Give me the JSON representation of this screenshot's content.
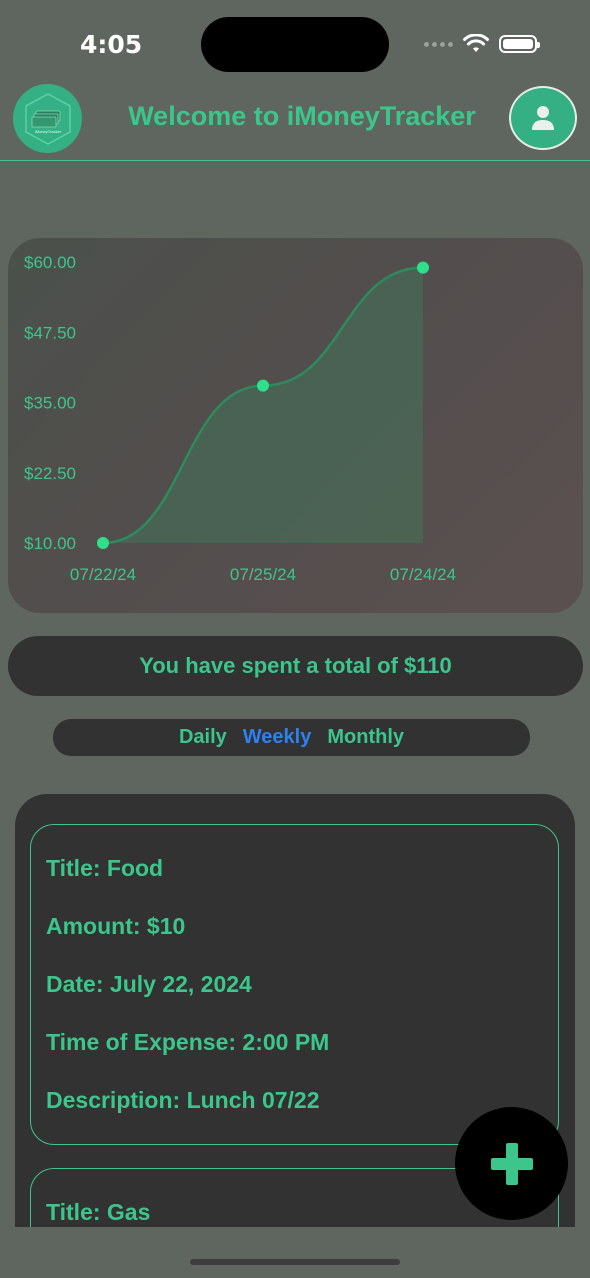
{
  "status_bar": {
    "time": "4:05"
  },
  "header": {
    "title": "Welcome to iMoneyTracker",
    "logo_text": "iMoneyTracker"
  },
  "chart_data": {
    "type": "line",
    "x": [
      "07/22/24",
      "07/25/24",
      "07/24/24"
    ],
    "values": [
      10,
      38,
      59
    ],
    "ytick_labels": [
      "$60.00",
      "$47.50",
      "$35.00",
      "$22.50",
      "$10.00"
    ],
    "ytick_values": [
      60,
      47.5,
      35,
      22.5,
      10
    ],
    "ylim": [
      10,
      60
    ],
    "area_fill": true,
    "smooth": true,
    "colors": {
      "line": "#2e8a5f",
      "point": "#2fe08a",
      "fill": "#3a8a62"
    }
  },
  "summary": {
    "total_text": "You have spent a total of $110"
  },
  "period_selector": {
    "options": [
      "Daily",
      "Weekly",
      "Monthly"
    ],
    "selected": "Weekly"
  },
  "expenses": [
    {
      "title": "Title: Food",
      "amount": "Amount: $10",
      "date": "Date: July 22, 2024",
      "time": "Time of Expense: 2:00 PM",
      "description": "Description: Lunch 07/22"
    },
    {
      "title": "Title: Gas"
    }
  ],
  "colors": {
    "accent": "#3cc68c",
    "background": "#5f6660",
    "panel": "#323232",
    "selected": "#2f7ff0"
  },
  "icons": {
    "add": "plus-icon",
    "profile": "person-icon",
    "logo": "money-stack-icon"
  }
}
